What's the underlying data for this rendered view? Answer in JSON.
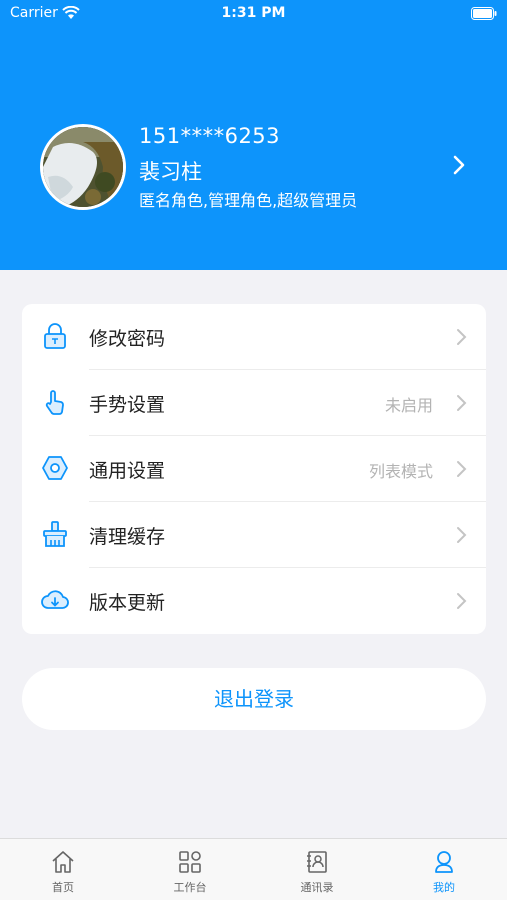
{
  "status_bar": {
    "carrier": "Carrier",
    "time": "1:31 PM",
    "wifi_icon": "wifi-icon",
    "battery_icon": "battery-icon"
  },
  "profile": {
    "phone": "151****6253",
    "name": "裴习柱",
    "roles": "匿名角色,管理角色,超级管理员",
    "avatar": "avatar-photo",
    "arrow_icon": "chevron-right-icon"
  },
  "menu": {
    "items": [
      {
        "icon": "lock-icon",
        "label": "修改密码",
        "value": ""
      },
      {
        "icon": "gesture-icon",
        "label": "手势设置",
        "value": "未启用"
      },
      {
        "icon": "hex-nut-icon",
        "label": "通用设置",
        "value": "列表模式"
      },
      {
        "icon": "broom-icon",
        "label": "清理缓存",
        "value": ""
      },
      {
        "icon": "cloud-download-icon",
        "label": "版本更新",
        "value": ""
      }
    ]
  },
  "logout": {
    "label": "退出登录"
  },
  "tabbar": {
    "active": "我的",
    "tabs": [
      {
        "icon": "home-icon",
        "label": "首页"
      },
      {
        "icon": "grid-icon",
        "label": "工作台"
      },
      {
        "icon": "contacts-icon",
        "label": "通讯录"
      },
      {
        "icon": "user-icon",
        "label": "我的"
      }
    ]
  },
  "colors": {
    "accent": "#0d94fb",
    "background": "#f2f2f6",
    "muted_text": "#b3b3b3"
  }
}
